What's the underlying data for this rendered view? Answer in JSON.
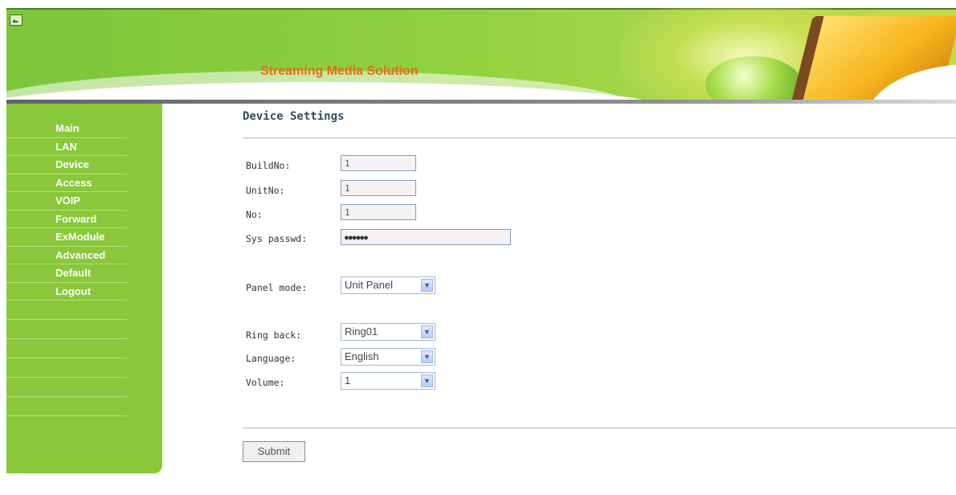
{
  "header": {
    "title": "Streaming Media Solution",
    "icon": "image-icon"
  },
  "sidebar": {
    "items": [
      {
        "label": "Main"
      },
      {
        "label": "LAN"
      },
      {
        "label": "Device"
      },
      {
        "label": "Access"
      },
      {
        "label": "VOIP"
      },
      {
        "label": "Forward"
      },
      {
        "label": "ExModule"
      },
      {
        "label": "Advanced"
      },
      {
        "label": "Default"
      },
      {
        "label": "Logout"
      }
    ]
  },
  "main": {
    "title": "Device Settings",
    "fields": {
      "buildno": {
        "label": "BuildNo:",
        "value": "1"
      },
      "unitno": {
        "label": "UnitNo:",
        "value": "1"
      },
      "no": {
        "label": "No:",
        "value": "1"
      },
      "sys_passwd": {
        "label": "Sys passwd:",
        "value": "●●●●●●"
      },
      "panel_mode": {
        "label": "Panel mode:",
        "value": "Unit Panel"
      },
      "ring_back": {
        "label": "Ring back:",
        "value": "Ring01"
      },
      "language": {
        "label": "Language:",
        "value": "English"
      },
      "volume": {
        "label": "Volume:",
        "value": "1"
      }
    },
    "submit_label": "Submit"
  },
  "colors": {
    "sidebar": "#88c83a",
    "title_accent": "#e9691a",
    "page_title": "#2f4f62"
  }
}
